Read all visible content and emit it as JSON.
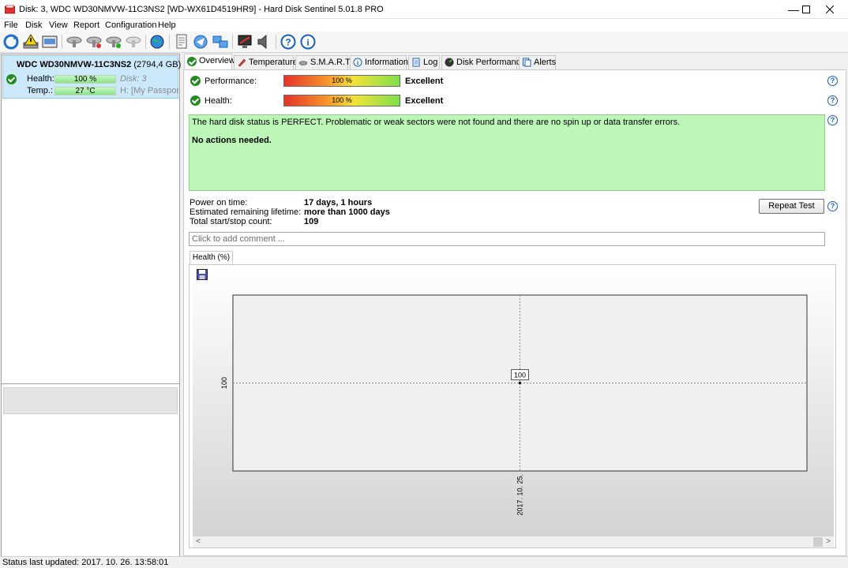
{
  "window": {
    "title": "Disk: 3, WDC WD30NMVW-11C3NS2 [WD-WX61D4519HR9]  -  Hard Disk Sentinel 5.01.8 PRO",
    "minimize": "—",
    "maximize": "☐",
    "close": "✕"
  },
  "menu": [
    "File",
    "Disk",
    "View",
    "Report",
    "Configuration",
    "Help"
  ],
  "toolbar_icons": [
    "refresh-icon",
    "warning-disk-icon",
    "disk-info-icon",
    "disk1-icon",
    "disk2-icon",
    "disk3-icon",
    "disk4-icon",
    "globe-icon",
    "report-icon",
    "send-icon",
    "network-icon",
    "monitor-icon",
    "speaker-icon",
    "help-icon",
    "info-icon"
  ],
  "disk": {
    "name": "WDC WD30NMVW-11C3NS2",
    "size": "(2794,4 GB)",
    "health_label": "Health:",
    "health_value": "100 %",
    "disk_no": "Disk: 3",
    "temp_label": "Temp.:",
    "temp_value": "27 °C",
    "volume": "H: [My Passport Ult"
  },
  "tabs": [
    {
      "label": "Overview",
      "icon": "check-icon"
    },
    {
      "label": "Temperature",
      "icon": "thermometer-icon"
    },
    {
      "label": "S.M.A.R.T.",
      "icon": "smart-icon"
    },
    {
      "label": "Information",
      "icon": "info-icon"
    },
    {
      "label": "Log",
      "icon": "log-icon"
    },
    {
      "label": "Disk Performance",
      "icon": "performance-icon"
    },
    {
      "label": "Alerts",
      "icon": "alerts-icon"
    }
  ],
  "overview": {
    "performance_label": "Performance:",
    "performance_value": "100 %",
    "performance_pct": 100,
    "performance_rating": "Excellent",
    "health_label": "Health:",
    "health_value": "100 %",
    "health_pct": 100,
    "health_rating": "Excellent",
    "status_text": "The hard disk status is PERFECT. Problematic or weak sectors were not found and there are no spin up or data transfer errors.",
    "action_text": "No actions needed.",
    "power_on_label": "Power on time:",
    "power_on_value": "17 days, 1 hours",
    "lifetime_label": "Estimated remaining lifetime:",
    "lifetime_value": "more than 1000 days",
    "startstop_label": "Total start/stop count:",
    "startstop_value": "109",
    "repeat_test": "Repeat Test",
    "comment_placeholder": "Click to add comment ...",
    "health_tab": "Health (%)"
  },
  "chart_data": {
    "type": "line",
    "x": [
      "2017. 10. 25."
    ],
    "series": [
      {
        "values": [
          100
        ]
      }
    ],
    "title": "",
    "xlabel": "",
    "ylabel": "",
    "ytick_labels": [
      "100"
    ],
    "xtick_labels": [
      "2017. 10. 25."
    ],
    "data_labels": [
      "100"
    ],
    "grid": true
  },
  "status": {
    "text": "Status last updated: 2017. 10. 26. 13:58:01"
  },
  "colors": {
    "selected_disk_bg": "#cce9fb",
    "status_ok_bg": "#bdf7b8",
    "check_green": "#228b22"
  }
}
